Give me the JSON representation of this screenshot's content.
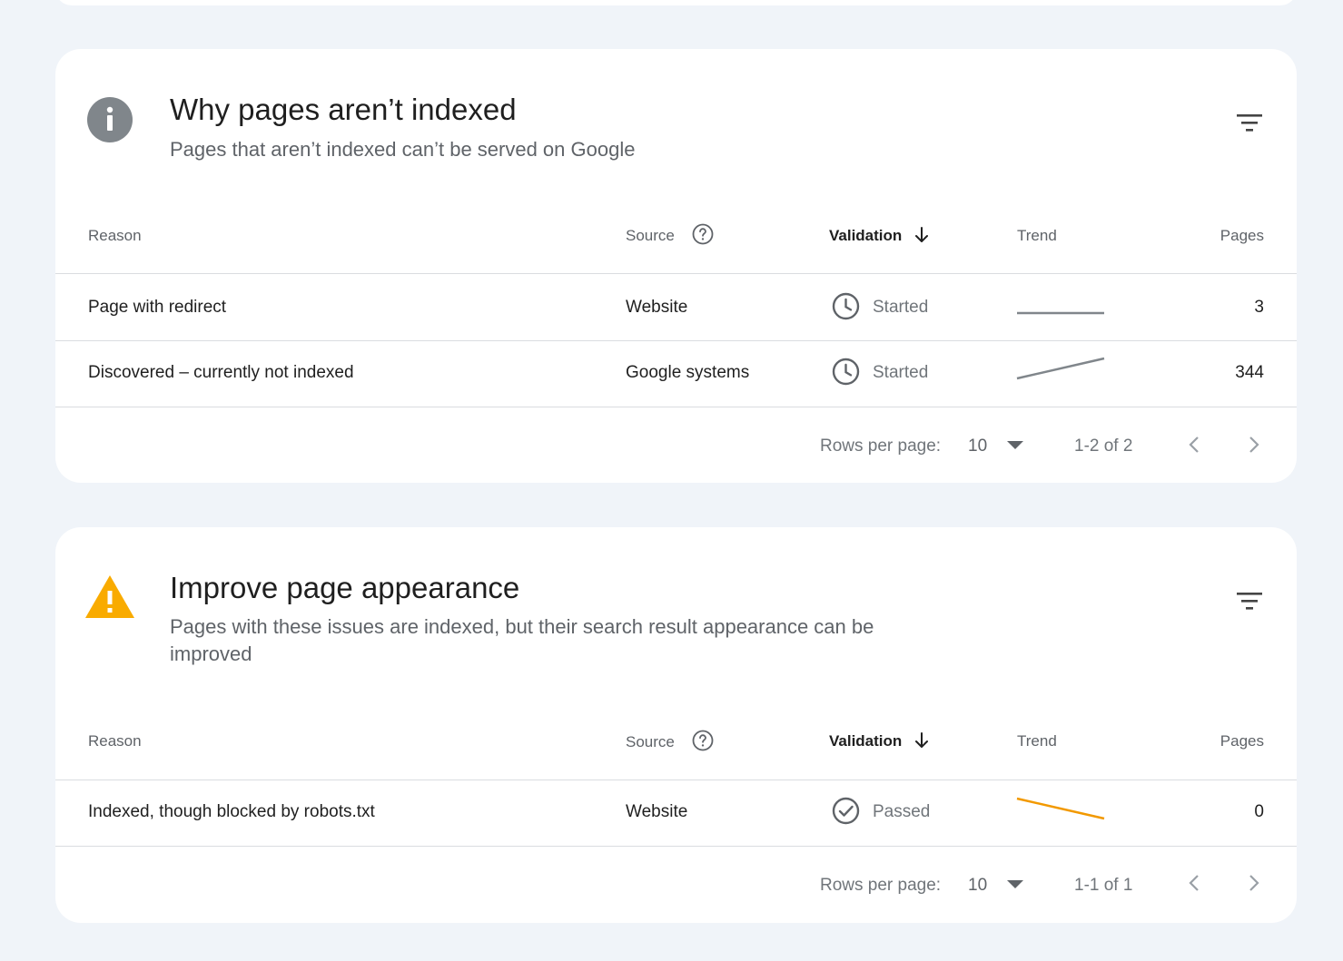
{
  "sections": [
    {
      "title": "Why pages aren’t indexed",
      "subtitle": "Pages that aren’t indexed can’t be served on Google",
      "icon": "info-icon",
      "headers": {
        "reason": "Reason",
        "source": "Source",
        "validation": "Validation",
        "trend": "Trend",
        "pages": "Pages"
      },
      "rows": [
        {
          "reason": "Page with redirect",
          "source": "Website",
          "validation": "Started",
          "validation_icon": "clock-icon",
          "trend": "flat",
          "pages": "3"
        },
        {
          "reason": "Discovered – currently not indexed",
          "source": "Google systems",
          "validation": "Started",
          "validation_icon": "clock-icon",
          "trend": "rising",
          "pages": "344"
        }
      ],
      "pagination": {
        "rows_per_page_label": "Rows per page:",
        "rows_per_page": "10",
        "range": "1-2 of 2"
      }
    },
    {
      "title": "Improve page appearance",
      "subtitle": "Pages with these issues are indexed, but their search result appearance can be improved",
      "icon": "warning-icon",
      "headers": {
        "reason": "Reason",
        "source": "Source",
        "validation": "Validation",
        "trend": "Trend",
        "pages": "Pages"
      },
      "rows": [
        {
          "reason": "Indexed, though blocked by robots.txt",
          "source": "Website",
          "validation": "Passed",
          "validation_icon": "check-circle-icon",
          "trend": "falling",
          "pages": "0"
        }
      ],
      "pagination": {
        "rows_per_page_label": "Rows per page:",
        "rows_per_page": "10",
        "range": "1-1 of 1"
      }
    }
  ],
  "colors": {
    "page_background": "#f0f4f9",
    "card_background": "#ffffff",
    "info_icon": "#80868b",
    "warning_icon": "#f9ab00",
    "trend_gray": "#80868b",
    "trend_orange": "#f29900"
  }
}
